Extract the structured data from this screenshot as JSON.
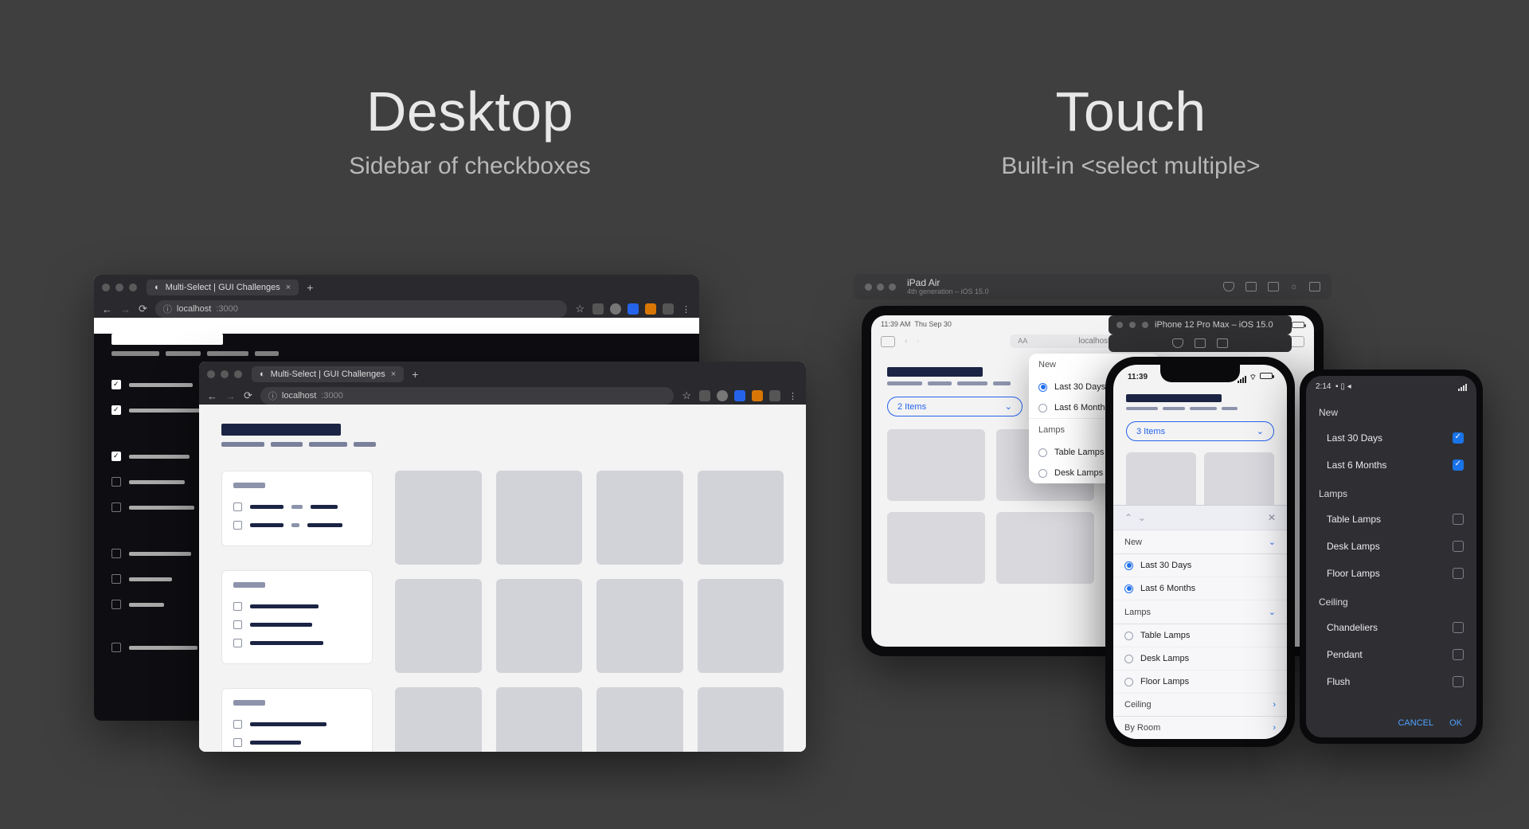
{
  "sections": {
    "desktop": {
      "title": "Desktop",
      "subtitle": "Sidebar of checkboxes"
    },
    "touch": {
      "title": "Touch",
      "subtitle": "Built-in <select multiple>"
    }
  },
  "browser": {
    "tab_title": "Multi-Select | GUI Challenges",
    "url_host": "localhost",
    "url_port": ":3000",
    "info_icon": "ⓘ"
  },
  "ipad_sim": {
    "title": "iPad Air",
    "subtitle": "4th generation – iOS 15.0",
    "status_time": "11:39 AM",
    "status_date": "Thu Sep 30",
    "url": "localhost",
    "aa": "AA"
  },
  "ipad_popover": {
    "groups": [
      {
        "label": "New",
        "options": [
          {
            "label": "Last 30 Days",
            "selected": true
          },
          {
            "label": "Last 6 Months",
            "selected": false
          }
        ]
      },
      {
        "label": "Lamps",
        "options": [
          {
            "label": "Table Lamps",
            "selected": false
          },
          {
            "label": "Desk Lamps",
            "selected": false
          }
        ]
      }
    ]
  },
  "ipad_pill": {
    "label": "2 Items"
  },
  "iphone_sim": {
    "title": "iPhone 12 Pro Max – iOS 15.0"
  },
  "iphone": {
    "status_time": "11:39",
    "pill_label": "3 Items"
  },
  "iphone_sheet": {
    "close_nav": {
      "up": "⌃",
      "down": "⌄",
      "close": "✕"
    },
    "groups": [
      {
        "label": "New",
        "chev": "⌄",
        "options": [
          {
            "label": "Last 30 Days",
            "selected": true
          },
          {
            "label": "Last 6 Months",
            "selected": true
          }
        ]
      },
      {
        "label": "Lamps",
        "chev": "⌄",
        "options": [
          {
            "label": "Table Lamps",
            "selected": false
          },
          {
            "label": "Desk Lamps",
            "selected": false
          },
          {
            "label": "Floor Lamps",
            "selected": false
          }
        ]
      },
      {
        "label": "Ceiling",
        "chev": "›",
        "options": []
      },
      {
        "label": "By Room",
        "chev": "›",
        "options": []
      }
    ]
  },
  "android": {
    "status_time": "2:14",
    "groups": [
      {
        "label": "New",
        "options": [
          {
            "label": "Last 30 Days",
            "checked": true
          },
          {
            "label": "Last 6 Months",
            "checked": true
          }
        ]
      },
      {
        "label": "Lamps",
        "options": [
          {
            "label": "Table Lamps",
            "checked": false
          },
          {
            "label": "Desk Lamps",
            "checked": false
          },
          {
            "label": "Floor Lamps",
            "checked": false
          }
        ]
      },
      {
        "label": "Ceiling",
        "options": [
          {
            "label": "Chandeliers",
            "checked": false
          },
          {
            "label": "Pendant",
            "checked": false
          },
          {
            "label": "Flush",
            "checked": false
          }
        ]
      }
    ],
    "footer": {
      "cancel": "CANCEL",
      "ok": "OK"
    }
  }
}
